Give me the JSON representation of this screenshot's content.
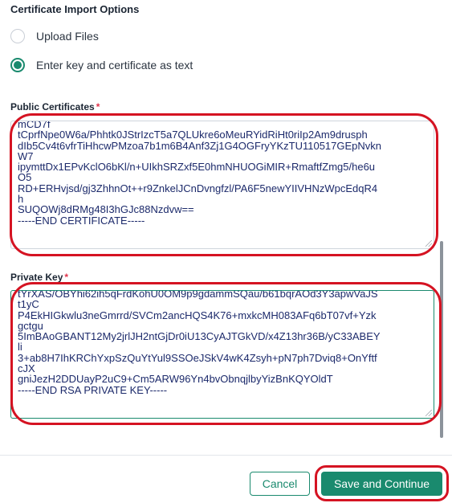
{
  "section_title": "Certificate Import Options",
  "import_options": [
    {
      "label": "Upload Files",
      "selected": false
    },
    {
      "label": "Enter key and certificate as text",
      "selected": true
    }
  ],
  "public_certificates": {
    "label": "Public Certificates",
    "required_mark": "*",
    "lines": [
      "mCD7f",
      "tCprfNpe0W6a/Phhtk0JStrIzcT5a7QLUkre6oMeuRYidRiHt0riIp2Am9drusph",
      "dIb5Cv4t6vfrTiHhcwPMzoa7b1m6B4Anf3Zj1G4OGFryYKzTU110517GEpNvkn",
      "W7",
      "ipymttDx1EPvKclO6bKl/n+UIkhSRZxf5E0hmNHUOGiMIR+RmaftfZmg5/he6u",
      "O5",
      "RD+ERHvjsd/gj3ZhhnOt++r9ZnkelJCnDvngfzl/PA6F5newYIIVHNzWpcEdqR4",
      "h",
      "SUQOWj8dRMg48I3hGJc88Nzdvw==",
      "-----END CERTIFICATE-----"
    ]
  },
  "private_key": {
    "label": "Private Key",
    "required_mark": "*",
    "lines": [
      "tYrXAS/OBYhi62ih5qFrdKohU0OM9p9gdammSQau/b61bqrAOd3Y3apwVaJS",
      "t1yC",
      "P4EkHIGkwlu3neGmrrd/SVCm2ancHQS4K76+mxkcMH083AFq6bT07vf+Yzk",
      "gctgu",
      "5ImBAoGBANT12My2jrlJH2ntGjDr0iU13CyAJTGkVD/x4Z13hr36B/yC33ABEY",
      "li",
      "3+ab8H7IhKRChYxpSzQuYtYul9SSOeJSkV4wK4Zsyh+pN7ph7Dviq8+OnYftf",
      "cJX",
      "gniJezH2DDUayP2uC9+Cm5ARW96Yn4bvObnqjlbyYizBnKQYOldT",
      "-----END RSA PRIVATE KEY-----"
    ]
  },
  "buttons": {
    "cancel": "Cancel",
    "save": "Save and Continue"
  },
  "colors": {
    "accent": "#1a8a6e",
    "required": "#e0334b",
    "annotation": "#d51322"
  }
}
